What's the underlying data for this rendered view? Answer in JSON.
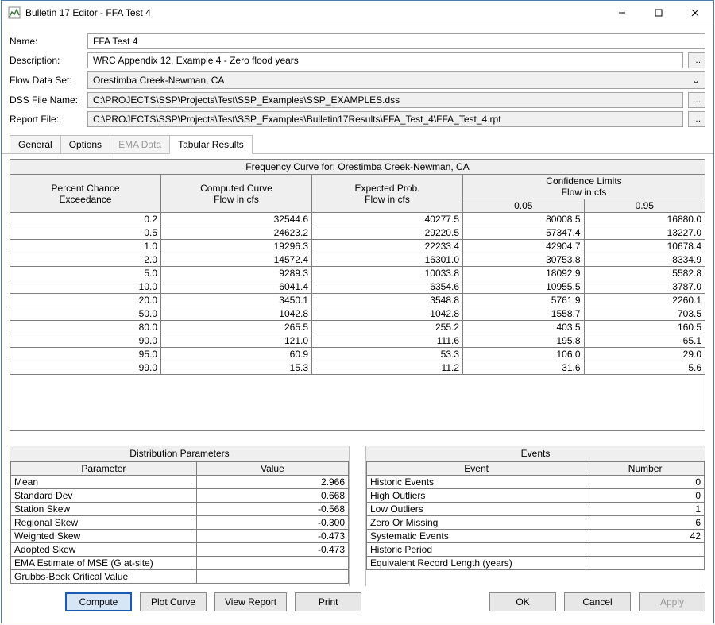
{
  "titlebar": {
    "title": "Bulletin 17 Editor - FFA Test 4"
  },
  "form": {
    "labels": {
      "name": "Name:",
      "description": "Description:",
      "flow_data_set": "Flow Data Set:",
      "dss_file": "DSS File Name:",
      "report_file": "Report File:"
    },
    "values": {
      "name": "FFA Test 4",
      "description": "WRC Appendix 12, Example 4 - Zero flood years",
      "flow_data_set": "Orestimba Creek-Newman, CA",
      "dss_file": "C:\\PROJECTS\\SSP\\Projects\\Test\\SSP_Examples\\SSP_EXAMPLES.dss",
      "report_file": "C:\\PROJECTS\\SSP\\Projects\\Test\\SSP_Examples\\Bulletin17Results\\FFA_Test_4\\FFA_Test_4.rpt"
    }
  },
  "tabs": {
    "general": "General",
    "options": "Options",
    "ema": "EMA Data",
    "tabular": "Tabular Results"
  },
  "freq": {
    "caption": "Frequency Curve for: Orestimba Creek-Newman, CA",
    "headers": {
      "percent": "Percent Chance\nExceedance",
      "computed": "Computed Curve\nFlow in cfs",
      "expected": "Expected Prob.\nFlow in cfs",
      "conf": "Confidence Limits\nFlow in cfs",
      "c005": "0.05",
      "c095": "0.95"
    },
    "rows": [
      {
        "p": "0.2",
        "c": "32544.6",
        "e": "40277.5",
        "l": "80008.5",
        "r": "16880.0"
      },
      {
        "p": "0.5",
        "c": "24623.2",
        "e": "29220.5",
        "l": "57347.4",
        "r": "13227.0"
      },
      {
        "p": "1.0",
        "c": "19296.3",
        "e": "22233.4",
        "l": "42904.7",
        "r": "10678.4"
      },
      {
        "p": "2.0",
        "c": "14572.4",
        "e": "16301.0",
        "l": "30753.8",
        "r": "8334.9"
      },
      {
        "p": "5.0",
        "c": "9289.3",
        "e": "10033.8",
        "l": "18092.9",
        "r": "5582.8"
      },
      {
        "p": "10.0",
        "c": "6041.4",
        "e": "6354.6",
        "l": "10955.5",
        "r": "3787.0"
      },
      {
        "p": "20.0",
        "c": "3450.1",
        "e": "3548.8",
        "l": "5761.9",
        "r": "2260.1"
      },
      {
        "p": "50.0",
        "c": "1042.8",
        "e": "1042.8",
        "l": "1558.7",
        "r": "703.5"
      },
      {
        "p": "80.0",
        "c": "265.5",
        "e": "255.2",
        "l": "403.5",
        "r": "160.5"
      },
      {
        "p": "90.0",
        "c": "121.0",
        "e": "111.6",
        "l": "195.8",
        "r": "65.1"
      },
      {
        "p": "95.0",
        "c": "60.9",
        "e": "53.3",
        "l": "106.0",
        "r": "29.0"
      },
      {
        "p": "99.0",
        "c": "15.3",
        "e": "11.2",
        "l": "31.6",
        "r": "5.6"
      }
    ]
  },
  "dist": {
    "title": "Distribution Parameters",
    "headers": {
      "param": "Parameter",
      "value": "Value"
    },
    "rows": [
      {
        "k": "Mean",
        "v": "2.966"
      },
      {
        "k": "Standard Dev",
        "v": "0.668"
      },
      {
        "k": "Station Skew",
        "v": "-0.568"
      },
      {
        "k": "Regional Skew",
        "v": "-0.300"
      },
      {
        "k": "Weighted Skew",
        "v": "-0.473"
      },
      {
        "k": "Adopted Skew",
        "v": "-0.473"
      },
      {
        "k": "EMA Estimate of MSE (G at-site)",
        "v": ""
      },
      {
        "k": "Grubbs-Beck Critical Value",
        "v": ""
      }
    ]
  },
  "events": {
    "title": "Events",
    "headers": {
      "event": "Event",
      "number": "Number"
    },
    "rows": [
      {
        "k": "Historic Events",
        "v": "0"
      },
      {
        "k": "High Outliers",
        "v": "0"
      },
      {
        "k": "Low Outliers",
        "v": "1"
      },
      {
        "k": "Zero Or Missing",
        "v": "6"
      },
      {
        "k": "Systematic Events",
        "v": "42"
      },
      {
        "k": "Historic Period",
        "v": ""
      },
      {
        "k": "Equivalent Record Length (years)",
        "v": ""
      }
    ]
  },
  "buttons": {
    "compute": "Compute",
    "plot": "Plot Curve",
    "view": "View Report",
    "print": "Print",
    "ok": "OK",
    "cancel": "Cancel",
    "apply": "Apply"
  }
}
